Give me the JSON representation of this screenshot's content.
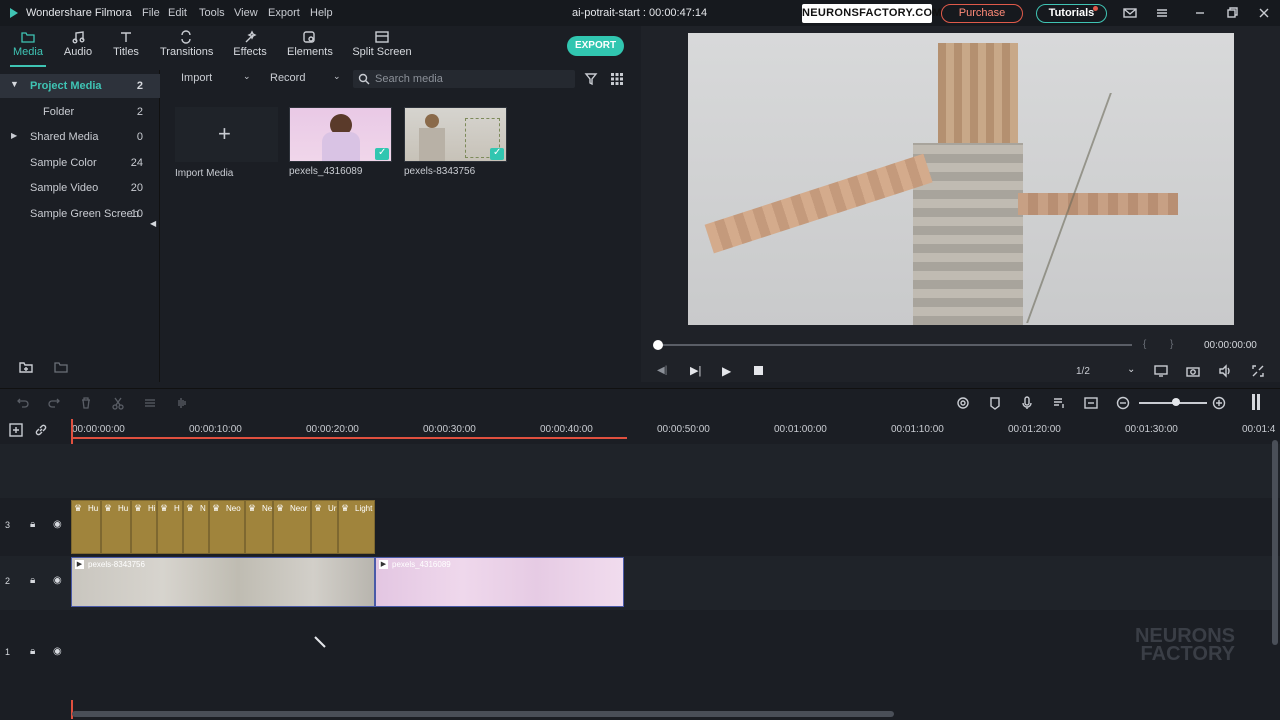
{
  "titlebar": {
    "app_name": "Wondershare Filmora",
    "menu": [
      "File",
      "Edit",
      "Tools",
      "View",
      "Export",
      "Help"
    ],
    "project_title": "ai-potrait-start : 00:00:47:14",
    "brand_badge": "NEURONSFACTORY.COM",
    "purchase_label": "Purchase",
    "tutorials_label": "Tutorials",
    "window_icons": [
      "mail-icon",
      "hamburger-menu-icon",
      "minimize-icon",
      "restore-icon",
      "close-icon"
    ]
  },
  "toolbar": {
    "tabs": [
      {
        "label": "Media",
        "icon": "folder-icon",
        "active": true
      },
      {
        "label": "Audio",
        "icon": "music-note-icon",
        "active": false
      },
      {
        "label": "Titles",
        "icon": "text-icon",
        "active": false
      },
      {
        "label": "Transitions",
        "icon": "transition-icon",
        "active": false
      },
      {
        "label": "Effects",
        "icon": "effects-icon",
        "active": false
      },
      {
        "label": "Elements",
        "icon": "elements-icon",
        "active": false
      },
      {
        "label": "Split Screen",
        "icon": "split-screen-icon",
        "active": false
      }
    ],
    "export_label": "EXPORT"
  },
  "sidebar": {
    "items": [
      {
        "label": "Project Media",
        "count": "2",
        "active": true
      },
      {
        "label": "Folder",
        "count": "2",
        "active": false
      },
      {
        "label": "Shared Media",
        "count": "0",
        "active": false
      },
      {
        "label": "Sample Color",
        "count": "24",
        "active": false
      },
      {
        "label": "Sample Video",
        "count": "20",
        "active": false
      },
      {
        "label": "Sample Green Screen",
        "count": "10",
        "active": false
      }
    ]
  },
  "media": {
    "import_label": "Import",
    "record_label": "Record",
    "search_placeholder": "Search media",
    "import_media_label": "Import Media",
    "clips": [
      {
        "name": "pexels_4316089"
      },
      {
        "name": "pexels-8343756"
      }
    ]
  },
  "preview": {
    "time": "00:00:00:00",
    "ratio": "1/2",
    "scrub_progress": 0.0
  },
  "timeline": {
    "ruler": [
      "00:00:00:00",
      "00:00:10:00",
      "00:00:20:00",
      "00:00:30:00",
      "00:00:40:00",
      "00:00:50:00",
      "00:01:00:00",
      "00:01:10:00",
      "00:01:20:00",
      "00:01:30:00",
      "00:01:4"
    ],
    "tracks": [
      {
        "label": "3"
      },
      {
        "label": "2"
      },
      {
        "label": "1"
      }
    ],
    "element_clips": [
      "Hu",
      "Hu",
      "Hi",
      "H",
      "N",
      "Neo",
      "Ne",
      "Neor",
      "Ur",
      "Light"
    ],
    "video_clips": [
      {
        "name": "pexels-8343756"
      },
      {
        "name": "pexels_4316089"
      }
    ],
    "watermark": "NEURONS FACTORY"
  },
  "colors": {
    "accent": "#3fc4b4",
    "playhead": "#e0503f",
    "element_clip": "#a0843c",
    "purchase": "#e05a4a"
  }
}
